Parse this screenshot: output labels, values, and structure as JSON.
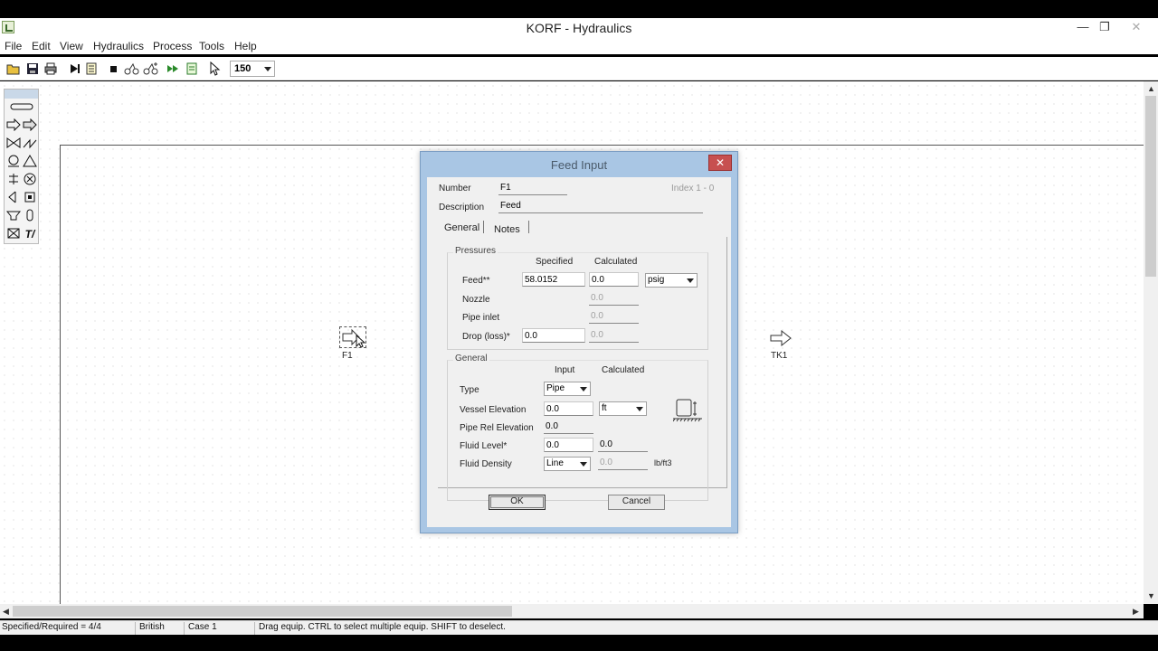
{
  "window": {
    "title": "KORF - Hydraulics",
    "minimize": "—",
    "restore": "❐",
    "close": "✕"
  },
  "menu": [
    "File",
    "Edit",
    "View",
    "Hydraulics",
    "Process",
    "Tools",
    "Help"
  ],
  "toolbar": {
    "buttons": [
      "open-icon",
      "save-icon",
      "print-icon",
      "step-run-icon",
      "report-icon",
      "stop-icon",
      "network-icon",
      "network-cases-icon",
      "run-all-icon",
      "export-icon",
      "pointer-icon"
    ],
    "zoom": "150"
  },
  "palette": {
    "icons": [
      "pipe-icon",
      "feed-icon",
      "product-icon",
      "valve-icon",
      "control-valve-icon",
      "fitting-icon",
      "tank-icon",
      "pump-icon",
      "compressor-icon",
      "orifice-icon",
      "exchanger-icon",
      "misc-equipment-icon",
      "reducer-icon",
      "column-icon",
      "check-valve-icon",
      "text-tool-icon"
    ]
  },
  "canvas": {
    "feed_label": "F1",
    "tank_label": "TK1"
  },
  "dialog": {
    "title": "Feed Input",
    "close": "✕",
    "number_label": "Number",
    "number_value": "F1",
    "index_text": "Index 1 - 0",
    "description_label": "Description",
    "description_value": "Feed",
    "tabs": [
      "General",
      "Notes"
    ],
    "pressures": {
      "title": "Pressures",
      "col_specified": "Specified",
      "col_calculated": "Calculated",
      "rows": [
        {
          "label": "Feed**",
          "specified": "58.0152",
          "calculated": "0.0"
        },
        {
          "label": "Nozzle",
          "specified": "",
          "calculated": "0.0"
        },
        {
          "label": "Pipe inlet",
          "specified": "",
          "calculated": "0.0"
        },
        {
          "label": "Drop (loss)*",
          "specified": "0.0",
          "calculated": "0.0"
        }
      ],
      "unit": "psig"
    },
    "general": {
      "title": "General",
      "col_input": "Input",
      "col_calculated": "Calculated",
      "type_label": "Type",
      "type_value": "Pipe",
      "vessel_elev_label": "Vessel Elevation",
      "vessel_elev_value": "0.0",
      "vessel_elev_unit": "ft",
      "pipe_rel_label": "Pipe Rel Elevation",
      "pipe_rel_value": "0.0",
      "fluid_level_label": "Fluid Level*",
      "fluid_level_input": "0.0",
      "fluid_level_calc": "0.0",
      "fluid_density_label": "Fluid Density",
      "fluid_density_value": "Line",
      "fluid_density_calc": "0.0",
      "fluid_density_unit": "lb/ft3"
    },
    "ok": "OK",
    "cancel": "Cancel"
  },
  "status": {
    "specified": "Specified/Required = 4/4",
    "units": "British",
    "case": "Case 1",
    "hint": "Drag equip. CTRL to select multiple equip. SHIFT to deselect."
  }
}
